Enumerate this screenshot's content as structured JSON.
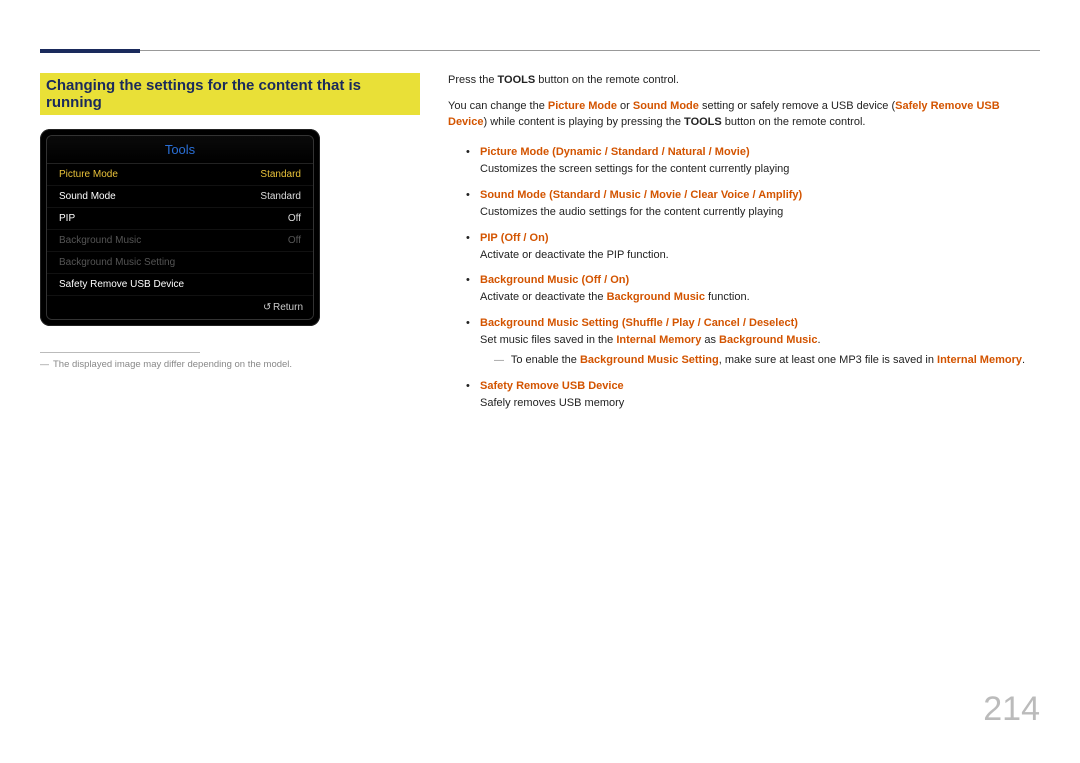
{
  "section_title": "Changing the settings for the content that is running",
  "device": {
    "header": "Tools",
    "rows": [
      {
        "label": "Picture Mode",
        "value": "Standard",
        "state": "selected"
      },
      {
        "label": "Sound Mode",
        "value": "Standard",
        "state": "normal"
      },
      {
        "label": "PIP",
        "value": "Off",
        "state": "normal"
      },
      {
        "label": "Background Music",
        "value": "Off",
        "state": "disabled"
      },
      {
        "label": "Background Music Setting",
        "value": "",
        "state": "disabled"
      },
      {
        "label": "Safety Remove USB Device",
        "value": "",
        "state": "normal"
      }
    ],
    "footer_return": "Return"
  },
  "footnote": "The displayed image may differ depending on the model.",
  "intro1": {
    "pre": "Press the ",
    "bold": "TOOLS",
    "post": " button on the remote control."
  },
  "intro2": {
    "t1": "You can change the ",
    "pm": "Picture Mode",
    "or": " or ",
    "sm": "Sound Mode",
    "t2": " setting or safely remove a USB device (",
    "sr": "Safely Remove USB Device",
    "t3": ") while content is playing by pressing the ",
    "tools": "TOOLS",
    "t4": " button on the remote control."
  },
  "items": {
    "picture_mode": {
      "label": "Picture Mode",
      "opts": [
        "Dynamic",
        "Standard",
        "Natural",
        "Movie"
      ],
      "desc": "Customizes the screen settings for the content currently playing"
    },
    "sound_mode": {
      "label": "Sound Mode",
      "opts": [
        "Standard",
        "Music",
        "Movie",
        "Clear Voice",
        "Amplify"
      ],
      "desc": "Customizes the audio settings for the content currently playing"
    },
    "pip": {
      "label": "PIP",
      "opts": [
        "Off",
        "On"
      ],
      "desc": "Activate or deactivate the PIP function."
    },
    "bgm": {
      "label": "Background Music",
      "opts": [
        "Off",
        "On"
      ],
      "desc_pre": "Activate or deactivate the ",
      "desc_bold": "Background Music",
      "desc_post": " function."
    },
    "bgms": {
      "label": "Background Music Setting",
      "opts": [
        "Shuffle",
        "Play",
        "Cancel",
        "Deselect"
      ],
      "desc_pre": "Set music files saved in the ",
      "im": "Internal Memory",
      "as": " as ",
      "bm": "Background Music",
      "dot": "."
    },
    "bgms_note": {
      "t1": "To enable the ",
      "b1": "Background Music Setting",
      "t2": ", make sure at least one MP3 file is saved in ",
      "b2": "Internal Memory",
      "t3": "."
    },
    "safety": {
      "label": "Safety Remove USB Device",
      "desc": "Safely removes USB memory"
    }
  },
  "page_number": "214"
}
